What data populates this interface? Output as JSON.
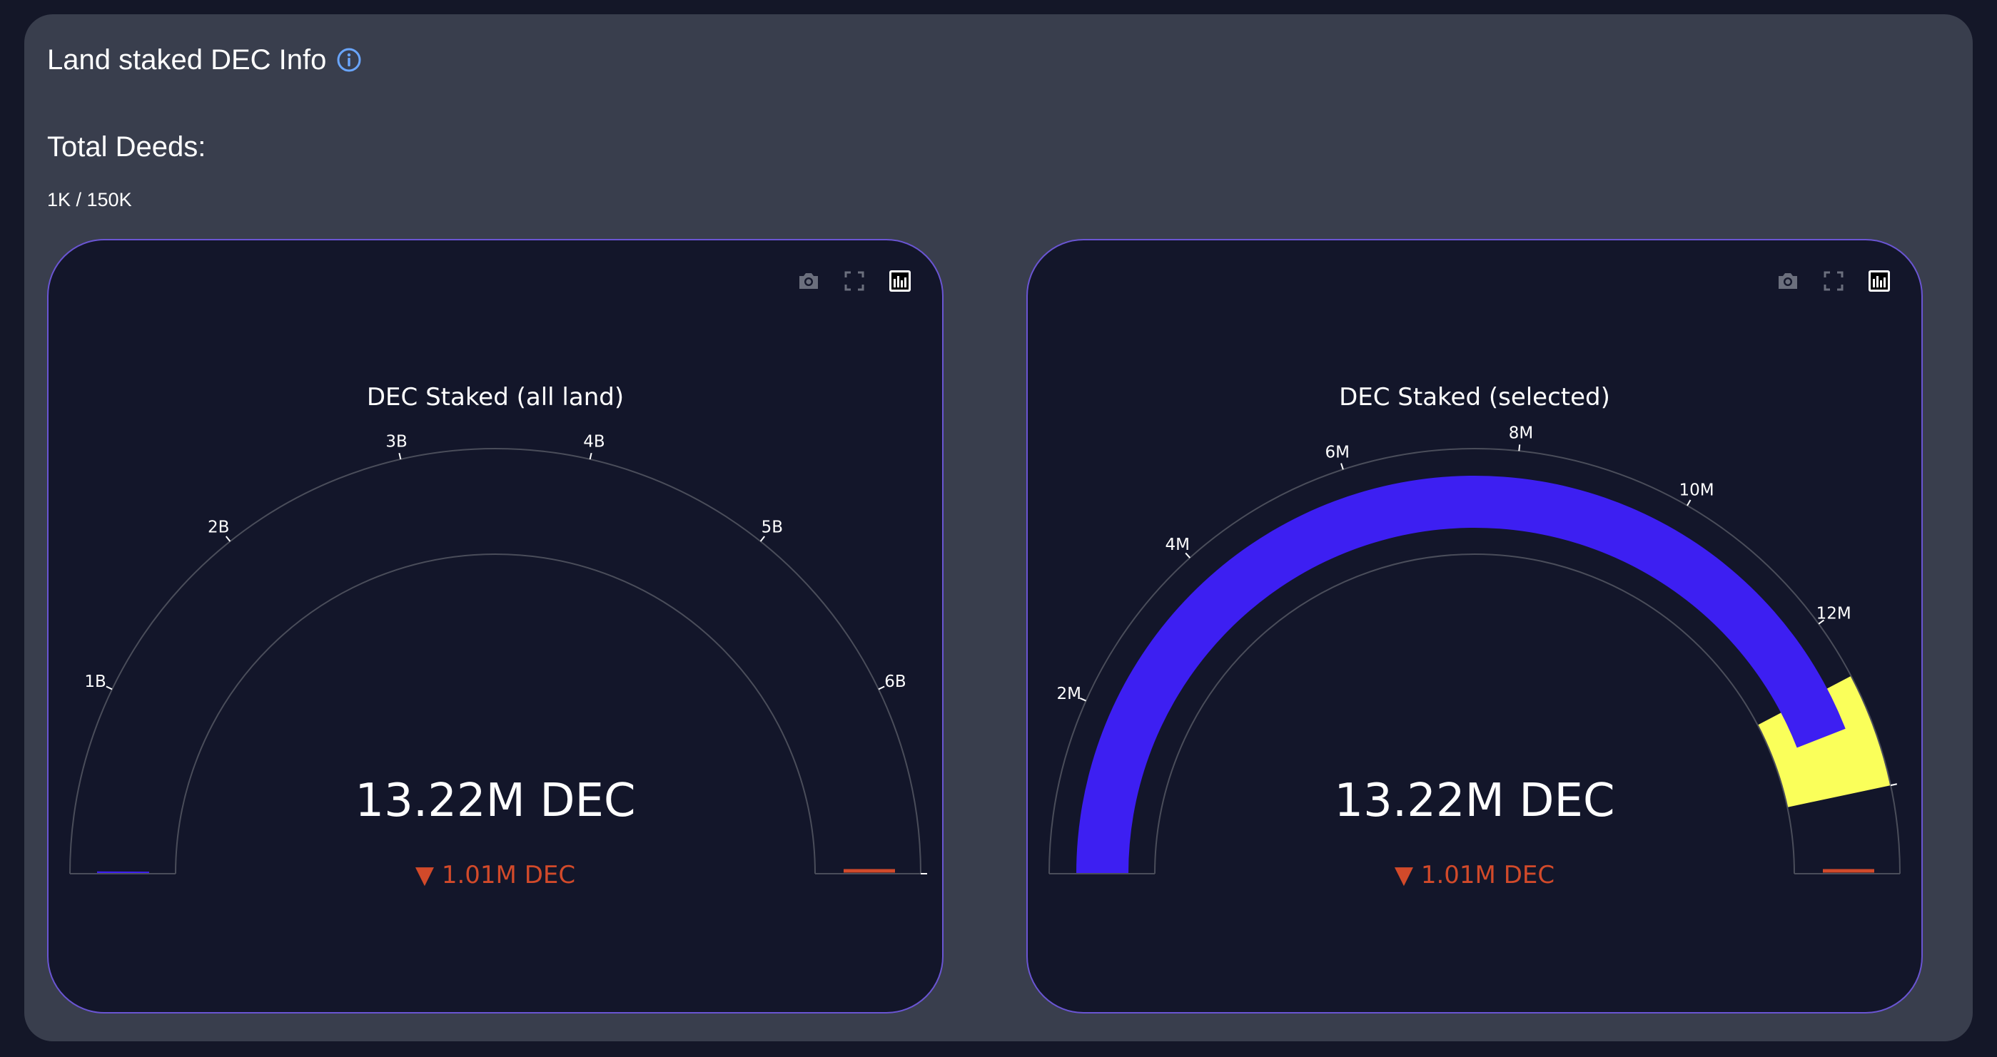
{
  "header": {
    "title": "Land staked DEC Info",
    "info_icon": "info-circle-icon"
  },
  "deeds": {
    "label": "Total Deeds:",
    "value": "1K / 150K"
  },
  "colors": {
    "panel_bg": "#393e4d",
    "card_bg": "#13162a",
    "card_border": "#6a55d3",
    "gauge_bar": "#3d1ff2",
    "threshold_band": "#faff5a",
    "delta_decrease": "#d24a2a",
    "info_icon": "#6aa6ff"
  },
  "modebar": {
    "icons": [
      "camera-icon",
      "fullscreen-icon",
      "plotly-logo-icon"
    ]
  },
  "chart_data": [
    {
      "type": "gauge",
      "title": "DEC Staked (all land)",
      "value_text": "13.22M DEC",
      "delta_text": "▼ 1.01M DEC",
      "value": 13220000,
      "reference": 14230000,
      "range": [
        0,
        7000000000
      ],
      "ticks": [
        {
          "value": 1000000000,
          "label": "1B"
        },
        {
          "value": 2000000000,
          "label": "2B"
        },
        {
          "value": 3000000000,
          "label": "3B"
        },
        {
          "value": 4000000000,
          "label": "4B"
        },
        {
          "value": 5000000000,
          "label": "5B"
        },
        {
          "value": 6000000000,
          "label": "6B"
        },
        {
          "value": 7000000000,
          "label": ""
        }
      ],
      "steps": [],
      "bar_color": "#3d1ff2"
    },
    {
      "type": "gauge",
      "title": "DEC Staked (selected)",
      "value_text": "13.22M DEC",
      "delta_text": "▼ 1.01M DEC",
      "value": 13220000,
      "reference": 14230000,
      "range": [
        0,
        15000000
      ],
      "ticks": [
        {
          "value": 2000000,
          "label": "2M"
        },
        {
          "value": 4000000,
          "label": "4M"
        },
        {
          "value": 6000000,
          "label": "6M"
        },
        {
          "value": 8000000,
          "label": "8M"
        },
        {
          "value": 10000000,
          "label": "10M"
        },
        {
          "value": 12000000,
          "label": "12M"
        },
        {
          "value": 14000000,
          "label": ""
        }
      ],
      "steps": [
        {
          "range": [
            12690000,
            14000000
          ],
          "color": "#faff5a"
        }
      ],
      "bar_color": "#3d1ff2"
    }
  ]
}
